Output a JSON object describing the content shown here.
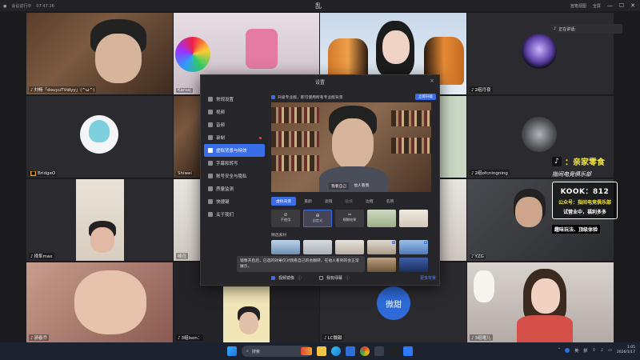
{
  "window": {
    "left_status": "会议进行中",
    "left_time": "07:47:26",
    "title": "乱",
    "right_label": "宫格视图",
    "right_mode": "全屏"
  },
  "participants": [
    {
      "name": "刘畅「douyuTVdiyy」(^ω^)"
    },
    {
      "name": "Karsaj"
    },
    {
      "name": ""
    },
    {
      "name": "2组月夜"
    },
    {
      "name": "BridgeO"
    },
    {
      "name": "Shiwei"
    },
    {
      "name": "2组ofcningning"
    },
    {
      "name": "择隼max"
    },
    {
      "name": "绮莅"
    },
    {
      "name": "YZG"
    },
    {
      "name": "骑春乔"
    },
    {
      "name": "3组Ison："
    },
    {
      "name": "LC微甜"
    },
    {
      "name": "3组曜儿"
    }
  ],
  "talking": "正在讲话:",
  "weitian_avatar": "微甜",
  "dialog": {
    "title": "设置",
    "close": "×",
    "sidebar": [
      {
        "label": "常规设置",
        "icon": "gear-icon"
      },
      {
        "label": "视频",
        "icon": "camera-icon"
      },
      {
        "label": "音频",
        "icon": "headphone-icon"
      },
      {
        "label": "录制",
        "icon": "record-icon"
      },
      {
        "label": "虚拟背景与特效",
        "icon": "background-icon"
      },
      {
        "label": "字幕和转写",
        "icon": "caption-icon"
      },
      {
        "label": "账号安全与隐私",
        "icon": "lock-icon"
      },
      {
        "label": "质量监测",
        "icon": "monitor-icon"
      },
      {
        "label": "快捷键",
        "icon": "keyboard-icon"
      },
      {
        "label": "关于我们",
        "icon": "info-icon"
      }
    ],
    "banner_text": "升级专业版，即可使用所有专业版背景",
    "banner_button": "立即升级",
    "preview_tabs": [
      "我看自己",
      "他人看我"
    ],
    "tabs": [
      "虚拟背景",
      "美颜",
      "滤镜",
      "贴纸",
      "边框",
      "名牌"
    ],
    "bg_options": [
      {
        "label": "不使用",
        "icon": "⊘"
      },
      {
        "label": "自定义",
        "icon": "⊕"
      },
      {
        "label": "模糊效果",
        "icon": "≈"
      }
    ],
    "section_label": "精选素材",
    "tooltip": "镜像开启后，已选的效果仅对我看自己的会翻转，在他人看到的会正常展示。",
    "mirror_label": "视频镜像",
    "green_label": "我有绿幕",
    "more_label": "更多背景"
  },
  "promo": {
    "line1": "：亲家零食",
    "line2": "指间电竞俱乐部",
    "kook": "KOOK：812",
    "gzh1": "公众号：指间电竞俱乐部",
    "gzh2": "试营业中，福利多多",
    "tag": "趣味玩法、顶级体验"
  },
  "taskbar": {
    "search_placeholder": "搜索",
    "lang1": "英",
    "lang2": "拼",
    "time": "1:05",
    "date": "2026/1/17"
  },
  "colors": {
    "accent": "#3a6ee8",
    "promo_yellow": "#f4e83a"
  }
}
